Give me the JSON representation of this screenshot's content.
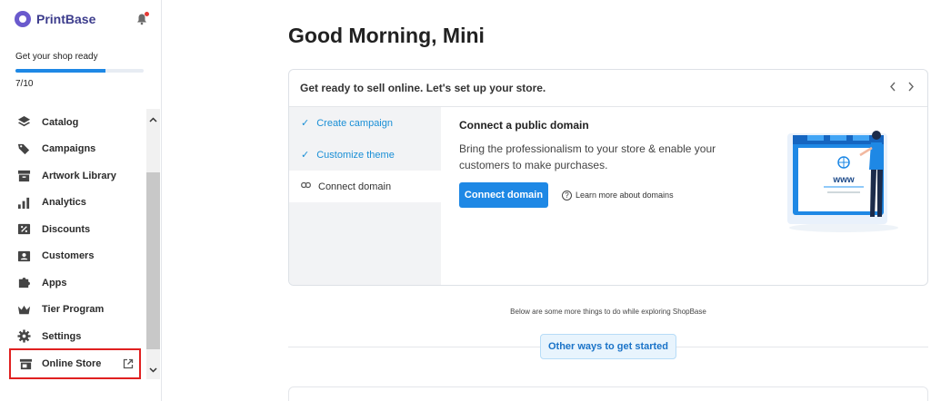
{
  "brand": {
    "name": "PrintBase"
  },
  "setup": {
    "label": "Get your shop ready",
    "progress_text": "7/10",
    "progress_fraction": 0.7
  },
  "sidebar": {
    "items": [
      {
        "label": "Catalog",
        "icon": "layers-icon"
      },
      {
        "label": "Campaigns",
        "icon": "tag-icon"
      },
      {
        "label": "Artwork Library",
        "icon": "archive-icon"
      },
      {
        "label": "Analytics",
        "icon": "bar-chart-icon"
      },
      {
        "label": "Discounts",
        "icon": "discount-icon"
      },
      {
        "label": "Customers",
        "icon": "customer-icon"
      },
      {
        "label": "Apps",
        "icon": "puzzle-icon"
      },
      {
        "label": "Tier Program",
        "icon": "crown-icon"
      },
      {
        "label": "Settings",
        "icon": "gear-icon"
      }
    ],
    "online_store": {
      "label": "Online Store",
      "icon": "store-icon"
    }
  },
  "main": {
    "greeting": "Good Morning, Mini",
    "card": {
      "title": "Get ready to sell online. Let's set up your store.",
      "steps": [
        {
          "label": "Create campaign",
          "state": "done"
        },
        {
          "label": "Customize theme",
          "state": "done"
        },
        {
          "label": "Connect domain",
          "state": "active"
        }
      ],
      "detail": {
        "title": "Connect a public domain",
        "text": "Bring the professionalism to your store & enable your customers to make purchases.",
        "button": "Connect domain",
        "learn_more": "Learn more about domains",
        "illustration_text": "www"
      }
    },
    "explore_text": "Below are some more things to do while exploring ShopBase",
    "ways_button": "Other ways to get started"
  },
  "colors": {
    "accent": "#1e88e5",
    "highlight_border": "#e02020",
    "brand": "#6a5acd"
  }
}
